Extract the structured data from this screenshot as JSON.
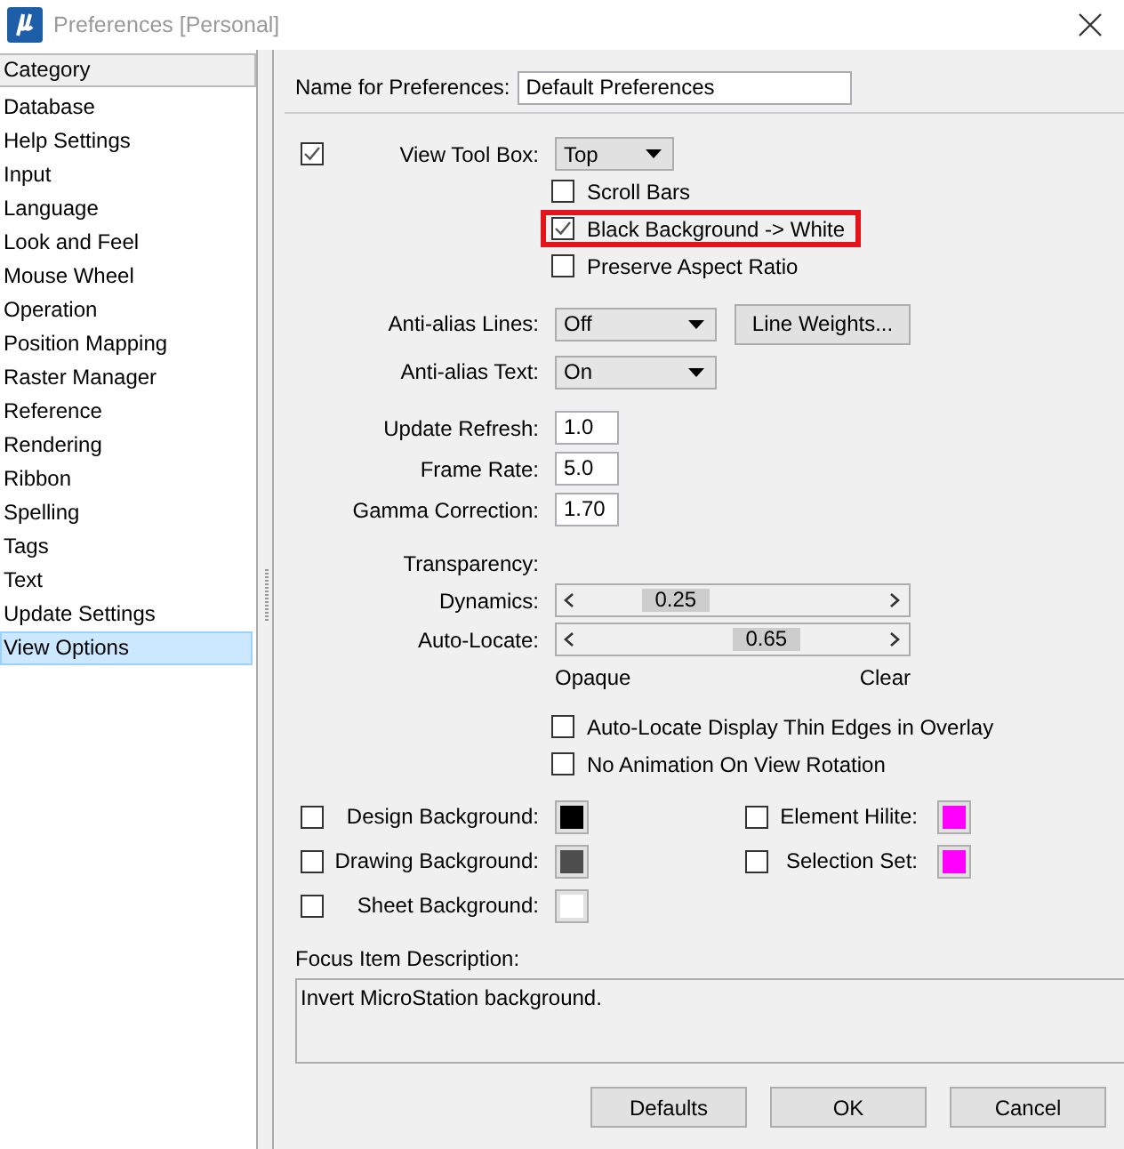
{
  "window": {
    "title": "Preferences [Personal]"
  },
  "sidebar": {
    "header": "Category",
    "items": [
      {
        "label": "Database",
        "selected": false
      },
      {
        "label": "Help Settings",
        "selected": false
      },
      {
        "label": "Input",
        "selected": false
      },
      {
        "label": "Language",
        "selected": false
      },
      {
        "label": "Look and Feel",
        "selected": false
      },
      {
        "label": "Mouse Wheel",
        "selected": false
      },
      {
        "label": "Operation",
        "selected": false
      },
      {
        "label": "Position Mapping",
        "selected": false
      },
      {
        "label": "Raster Manager",
        "selected": false
      },
      {
        "label": "Reference",
        "selected": false
      },
      {
        "label": "Rendering",
        "selected": false
      },
      {
        "label": "Ribbon",
        "selected": false
      },
      {
        "label": "Spelling",
        "selected": false
      },
      {
        "label": "Tags",
        "selected": false
      },
      {
        "label": "Text",
        "selected": false
      },
      {
        "label": "Update Settings",
        "selected": false
      },
      {
        "label": "View Options",
        "selected": true
      }
    ]
  },
  "name_field": {
    "label": "Name for Preferences:",
    "value": "Default Preferences"
  },
  "view_tool_box": {
    "checked": true,
    "label": "View Tool Box:",
    "value": "Top"
  },
  "options": [
    {
      "label": "Scroll Bars",
      "checked": false,
      "highlighted": false
    },
    {
      "label": "Black Background -> White",
      "checked": true,
      "highlighted": true
    },
    {
      "label": "Preserve Aspect Ratio",
      "checked": false,
      "highlighted": false
    }
  ],
  "anti_alias": [
    {
      "label": "Anti-alias Lines:",
      "value": "Off"
    },
    {
      "label": "Anti-alias Text:",
      "value": "On"
    }
  ],
  "line_weights_button": "Line Weights...",
  "numeric_fields": [
    {
      "label": "Update Refresh:",
      "value": "1.0"
    },
    {
      "label": "Frame Rate:",
      "value": "5.0"
    },
    {
      "label": "Gamma Correction:",
      "value": "1.70"
    }
  ],
  "transparency": {
    "label": "Transparency:",
    "sliders": [
      {
        "label": "Dynamics:",
        "level": 0.25,
        "reading": "0.25"
      },
      {
        "label": "Auto-Locate:",
        "level": 0.65,
        "reading": "0.65"
      }
    ],
    "min_label": "Opaque",
    "max_label": "Clear"
  },
  "display_options": [
    {
      "label": "Auto-Locate Display Thin Edges in Overlay",
      "checked": false
    },
    {
      "label": "No Animation On View Rotation",
      "checked": false
    }
  ],
  "colors_left": [
    {
      "label": "Design Background:",
      "checked": false,
      "color": "#000000"
    },
    {
      "label": "Drawing Background:",
      "checked": false,
      "color": "#4d4d4d"
    },
    {
      "label": "Sheet Background:",
      "checked": false,
      "color": "#ffffff"
    }
  ],
  "colors_right": [
    {
      "label": "Element Hilite:",
      "checked": false,
      "color": "#ff00ff"
    },
    {
      "label": "Selection Set:",
      "checked": false,
      "color": "#ff00ff"
    }
  ],
  "description": {
    "label": "Focus Item Description:",
    "text": "Invert MicroStation background."
  },
  "buttons": [
    "Defaults",
    "OK",
    "Cancel"
  ]
}
